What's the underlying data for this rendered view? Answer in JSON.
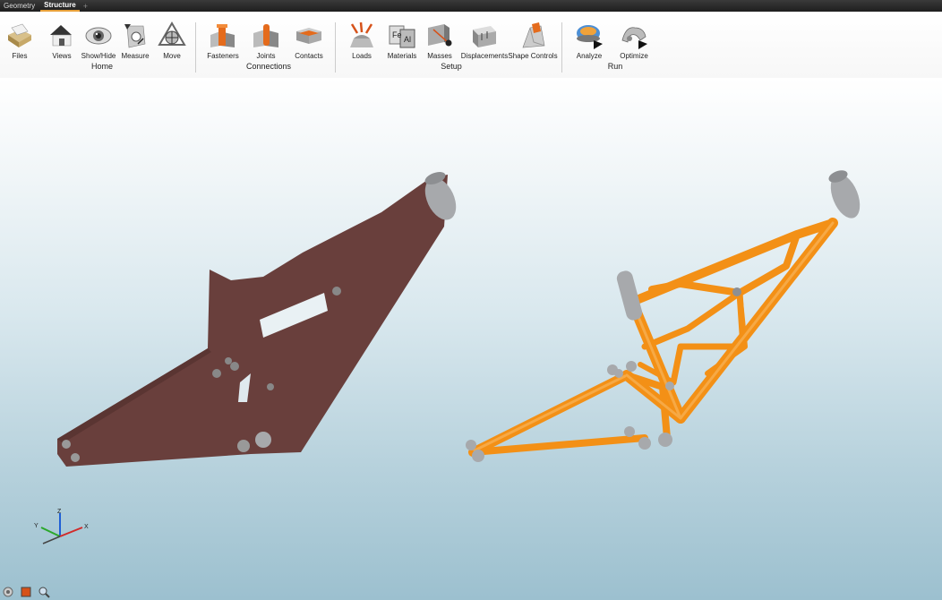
{
  "tabs": [
    {
      "label": "Geometry",
      "active": false
    },
    {
      "label": "Structure",
      "active": true
    }
  ],
  "tab_add_symbol": "+",
  "ribbon": {
    "tools": [
      {
        "label": "Files",
        "icon": "files-icon"
      },
      {
        "label": "Views",
        "icon": "views-icon"
      },
      {
        "label": "Show/Hide",
        "icon": "show-hide-icon"
      },
      {
        "label": "Measure",
        "icon": "measure-icon"
      },
      {
        "label": "Move",
        "icon": "move-icon"
      },
      {
        "label": "Fasteners",
        "icon": "fasteners-icon"
      },
      {
        "label": "Joints",
        "icon": "joints-icon"
      },
      {
        "label": "Contacts",
        "icon": "contacts-icon"
      },
      {
        "label": "Loads",
        "icon": "loads-icon"
      },
      {
        "label": "Materials",
        "icon": "materials-icon"
      },
      {
        "label": "Masses",
        "icon": "masses-icon"
      },
      {
        "label": "Displacements",
        "icon": "displacements-icon"
      },
      {
        "label": "Shape Controls",
        "icon": "shape-controls-icon"
      },
      {
        "label": "Analyze",
        "icon": "analyze-icon"
      },
      {
        "label": "Optimize",
        "icon": "optimize-icon"
      }
    ],
    "groups": {
      "home": "Home",
      "connections": "Connections",
      "setup": "Setup",
      "run": "Run"
    },
    "materials_icon_text": {
      "fe": "Fe",
      "al": "Al"
    }
  },
  "triad": {
    "x": "X",
    "y": "Y",
    "z": "Z"
  },
  "colors": {
    "design_space": "#693f3c",
    "optimized": "#f39016",
    "hardpoint": "#a7a9ac",
    "accent": "#e8a13a"
  }
}
